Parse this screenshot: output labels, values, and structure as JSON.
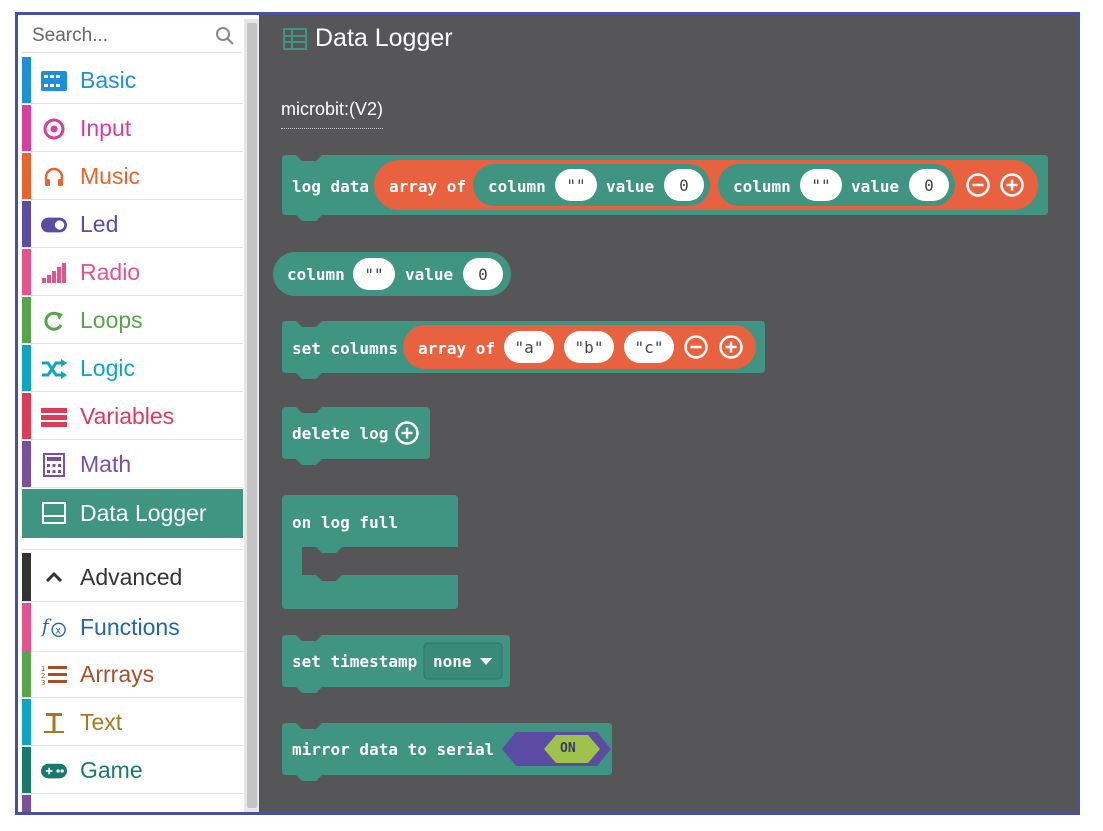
{
  "search": {
    "placeholder": "Search..."
  },
  "toolbox": {
    "categories": [
      {
        "label": "Basic",
        "color": "#1e90d6",
        "icon": "grid-icon"
      },
      {
        "label": "Input",
        "color": "#d4409c",
        "icon": "target-icon"
      },
      {
        "label": "Music",
        "color": "#e5652e",
        "icon": "headphones-icon"
      },
      {
        "label": "Led",
        "color": "#5c4ba3",
        "icon": "toggle-icon"
      },
      {
        "label": "Radio",
        "color": "#e3548f",
        "icon": "signal-icon"
      },
      {
        "label": "Loops",
        "color": "#58a44a",
        "icon": "refresh-icon"
      },
      {
        "label": "Logic",
        "color": "#0fa5c0",
        "icon": "shuffle-icon"
      },
      {
        "label": "Variables",
        "color": "#dc3b5a",
        "icon": "list-bars-icon"
      },
      {
        "label": "Math",
        "color": "#7c4f9e",
        "icon": "calculator-icon"
      },
      {
        "label": "Data Logger",
        "color": "#3f9482",
        "icon": "table-icon"
      },
      {
        "label": "Advanced",
        "color": "#333333",
        "icon": "chevron-up-icon"
      },
      {
        "label": "Functions",
        "color": "#1f64b5",
        "icon": "function-icon"
      },
      {
        "label": "Arrrays",
        "color": "#a6502a",
        "icon": "numbered-list-icon"
      },
      {
        "label": "Text",
        "color": "#a27a22",
        "icon": "text-icon"
      },
      {
        "label": "Game",
        "color": "#197a6c",
        "icon": "gamepad-icon"
      }
    ]
  },
  "flyout": {
    "title": "Data Logger",
    "subheading": "microbit:(V2)",
    "log_data": {
      "label": "log data",
      "array_label": "array of",
      "column_label": "column",
      "column_value": "\"\"",
      "value_label": "value",
      "value": "0"
    },
    "column_block": {
      "column_label": "column",
      "column_value": "\"\"",
      "value_label": "value",
      "value": "0"
    },
    "set_columns": {
      "label": "set columns",
      "array_label": "array of",
      "items": [
        "\"a\"",
        "\"b\"",
        "\"c\""
      ]
    },
    "delete_log": {
      "label": "delete log"
    },
    "on_log_full": {
      "label": "on log full"
    },
    "set_timestamp": {
      "label": "set timestamp",
      "dropdown": "none"
    },
    "mirror": {
      "label": "mirror data to serial",
      "toggle": "ON"
    }
  }
}
